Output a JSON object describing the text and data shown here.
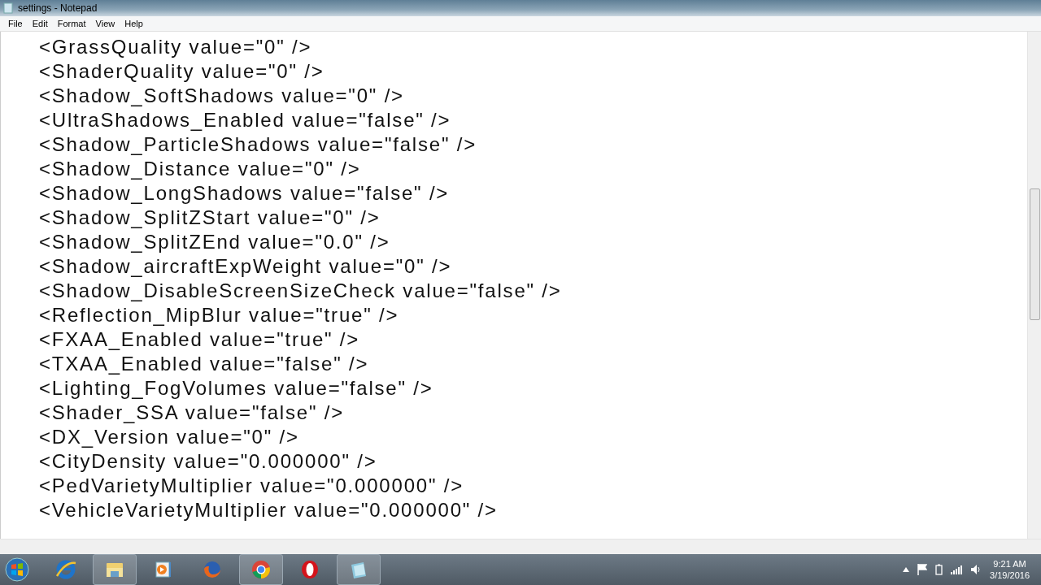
{
  "window": {
    "title": "settings - Notepad"
  },
  "menu": [
    "File",
    "Edit",
    "Format",
    "View",
    "Help"
  ],
  "lines": [
    "<GrassQuality value=\"0\" />",
    "<ShaderQuality value=\"0\" />",
    "<Shadow_SoftShadows value=\"0\" />",
    "<UltraShadows_Enabled value=\"false\" />",
    "<Shadow_ParticleShadows value=\"false\" />",
    "<Shadow_Distance value=\"0\" />",
    "<Shadow_LongShadows value=\"false\" />",
    "<Shadow_SplitZStart value=\"0\" />",
    "<Shadow_SplitZEnd value=\"0.0\" />",
    "<Shadow_aircraftExpWeight value=\"0\" />",
    "<Shadow_DisableScreenSizeCheck value=\"false\" />",
    "<Reflection_MipBlur value=\"true\" />",
    "<FXAA_Enabled value=\"true\" />",
    "<TXAA_Enabled value=\"false\" />",
    "<Lighting_FogVolumes value=\"false\" />",
    "<Shader_SSA value=\"false\" />",
    "<DX_Version value=\"0\" />",
    "<CityDensity value=\"0.000000\" />",
    "<PedVarietyMultiplier value=\"0.000000\" />",
    "<VehicleVarietyMultiplier value=\"0.000000\" />"
  ],
  "taskbar": {
    "apps": [
      {
        "kind": "ie",
        "open": false
      },
      {
        "kind": "folder",
        "open": true
      },
      {
        "kind": "media",
        "open": false
      },
      {
        "kind": "firefox",
        "open": false
      },
      {
        "kind": "chrome",
        "open": true
      },
      {
        "kind": "opera",
        "open": false
      },
      {
        "kind": "notepad",
        "open": true
      }
    ],
    "time": "9:21 AM",
    "date": "3/19/2016"
  }
}
